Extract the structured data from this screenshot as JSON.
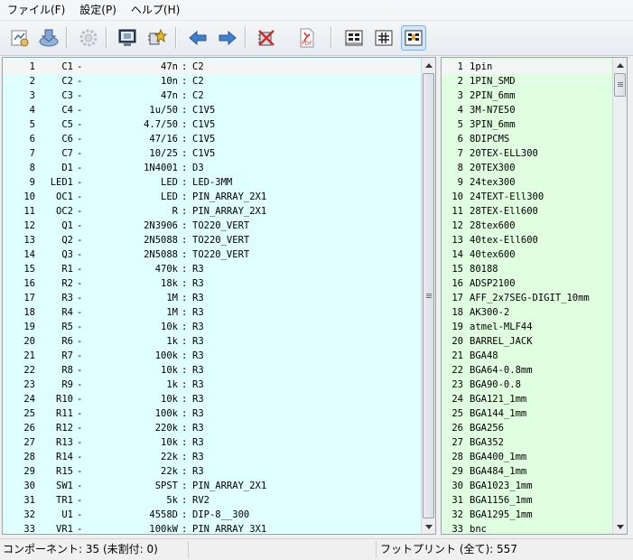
{
  "menu": [
    {
      "label": "ファイル(F)"
    },
    {
      "label": "設定(P)"
    },
    {
      "label": "ヘルプ(H)"
    }
  ],
  "components": [
    [
      "1",
      "C1",
      "47n",
      "C2"
    ],
    [
      "2",
      "C2",
      "10n",
      "C2"
    ],
    [
      "3",
      "C3",
      "47n",
      "C2"
    ],
    [
      "4",
      "C4",
      "1u/50",
      "C1V5"
    ],
    [
      "5",
      "C5",
      "4.7/50",
      "C1V5"
    ],
    [
      "6",
      "C6",
      "47/16",
      "C1V5"
    ],
    [
      "7",
      "C7",
      "10/25",
      "C1V5"
    ],
    [
      "8",
      "D1",
      "1N4001",
      "D3"
    ],
    [
      "9",
      "LED1",
      "LED",
      "LED-3MM"
    ],
    [
      "10",
      "OC1",
      "LED",
      "PIN_ARRAY_2X1"
    ],
    [
      "11",
      "OC2",
      "R",
      "PIN_ARRAY_2X1"
    ],
    [
      "12",
      "Q1",
      "2N3906",
      "TO220_VERT"
    ],
    [
      "13",
      "Q2",
      "2N5088",
      "TO220_VERT"
    ],
    [
      "14",
      "Q3",
      "2N5088",
      "TO220_VERT"
    ],
    [
      "15",
      "R1",
      "470k",
      "R3"
    ],
    [
      "16",
      "R2",
      "18k",
      "R3"
    ],
    [
      "17",
      "R3",
      "1M",
      "R3"
    ],
    [
      "18",
      "R4",
      "1M",
      "R3"
    ],
    [
      "19",
      "R5",
      "10k",
      "R3"
    ],
    [
      "20",
      "R6",
      "1k",
      "R3"
    ],
    [
      "21",
      "R7",
      "100k",
      "R3"
    ],
    [
      "22",
      "R8",
      "10k",
      "R3"
    ],
    [
      "23",
      "R9",
      "1k",
      "R3"
    ],
    [
      "24",
      "R10",
      "10k",
      "R3"
    ],
    [
      "25",
      "R11",
      "100k",
      "R3"
    ],
    [
      "26",
      "R12",
      "220k",
      "R3"
    ],
    [
      "27",
      "R13",
      "10k",
      "R3"
    ],
    [
      "28",
      "R14",
      "22k",
      "R3"
    ],
    [
      "29",
      "R15",
      "22k",
      "R3"
    ],
    [
      "30",
      "SW1",
      "SPST",
      "PIN_ARRAY_2X1"
    ],
    [
      "31",
      "TR1",
      "5k",
      "RV2"
    ],
    [
      "32",
      "U1",
      "4558D",
      "DIP-8__300"
    ],
    [
      "33",
      "VR1",
      "100kW",
      "PIN_ARRAY_3X1"
    ]
  ],
  "footprints": [
    [
      "1",
      "1pin"
    ],
    [
      "2",
      "1PIN_SMD"
    ],
    [
      "3",
      "2PIN_6mm"
    ],
    [
      "4",
      "3M-N7E50"
    ],
    [
      "5",
      "3PIN_6mm"
    ],
    [
      "6",
      "8DIPCMS"
    ],
    [
      "7",
      "20TEX-ELL300"
    ],
    [
      "8",
      "20TEX300"
    ],
    [
      "9",
      "24tex300"
    ],
    [
      "10",
      "24TEXT-Ell300"
    ],
    [
      "11",
      "28TEX-Ell600"
    ],
    [
      "12",
      "28tex600"
    ],
    [
      "13",
      "40tex-Ell600"
    ],
    [
      "14",
      "40tex600"
    ],
    [
      "15",
      "80188"
    ],
    [
      "16",
      "ADSP2100"
    ],
    [
      "17",
      "AFF_2x7SEG-DIGIT_10mm"
    ],
    [
      "18",
      "AK300-2"
    ],
    [
      "19",
      "atmel-MLF44"
    ],
    [
      "20",
      "BARREL_JACK"
    ],
    [
      "21",
      "BGA48"
    ],
    [
      "22",
      "BGA64-0.8mm"
    ],
    [
      "23",
      "BGA90-0.8"
    ],
    [
      "24",
      "BGA121_1mm"
    ],
    [
      "25",
      "BGA144_1mm"
    ],
    [
      "26",
      "BGA256"
    ],
    [
      "27",
      "BGA352"
    ],
    [
      "28",
      "BGA400_1mm"
    ],
    [
      "29",
      "BGA484_1mm"
    ],
    [
      "30",
      "BGA1023_1mm"
    ],
    [
      "31",
      "BGA1156_1mm"
    ],
    [
      "32",
      "BGA1295_1mm"
    ],
    [
      "33",
      "bnc"
    ]
  ],
  "status": {
    "components": "コンポーネント: 35 (未割付: 0)",
    "footprints": "フットプリント (全て): 557"
  },
  "colors": {
    "left_panel_bg": "#e0ffff",
    "right_panel_bg": "#e0ffe0"
  }
}
